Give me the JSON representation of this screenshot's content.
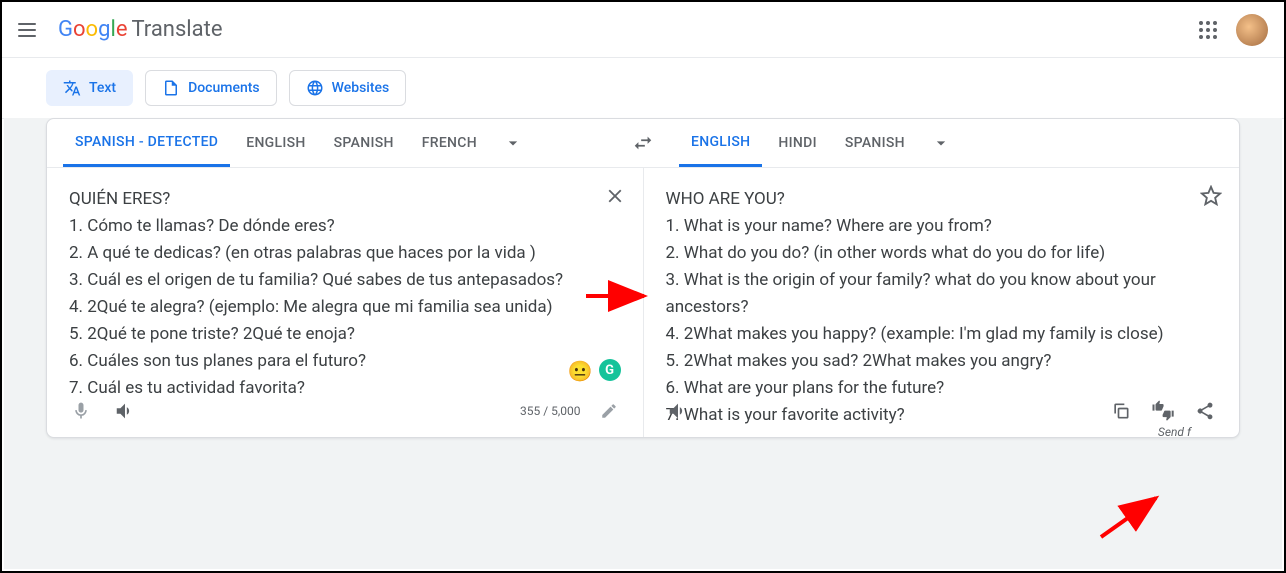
{
  "header": {
    "app_name_google": "Google",
    "app_name_translate": "Translate"
  },
  "modes": {
    "text": "Text",
    "documents": "Documents",
    "websites": "Websites"
  },
  "source_langs": [
    "SPANISH - DETECTED",
    "ENGLISH",
    "SPANISH",
    "FRENCH"
  ],
  "target_langs": [
    "ENGLISH",
    "HINDI",
    "SPANISH"
  ],
  "source_text": "QUIÉN ERES?\n1. Cómo te llamas? De dónde eres?\n2. A qué te dedicas? (en otras palabras que haces por la vida )\n3. Cuál es el origen de tu familia? Qué sabes de tus antepasados?\n4. 2Qué te alegra? (ejemplo: Me alegra que mi familia sea unida)\n5. 2Qué te pone triste? 2Qué te enoja?\n6. Cuáles son tus planes para el futuro?\n7. Cuál es tu actividad favorita?",
  "target_text": "WHO ARE YOU?\n1. What is your name? Where are you from?\n2. What do you do? (in other words what do you do for life)\n3. What is the origin of your family? what do you know about your ancestors?\n4. 2What makes you happy? (example: I'm glad my family is close)\n5. 2What makes you sad? 2What makes you angry?\n6. What are your plans for the future?\n7. What is your favorite activity?",
  "char_count": "355 / 5,000",
  "footer_link": "Send f"
}
